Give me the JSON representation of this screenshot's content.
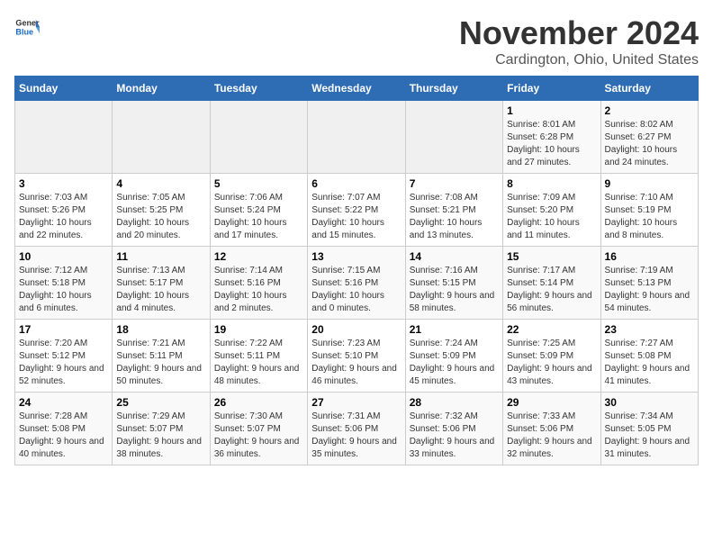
{
  "header": {
    "logo_general": "General",
    "logo_blue": "Blue",
    "title": "November 2024",
    "subtitle": "Cardington, Ohio, United States"
  },
  "calendar": {
    "days_of_week": [
      "Sunday",
      "Monday",
      "Tuesday",
      "Wednesday",
      "Thursday",
      "Friday",
      "Saturday"
    ],
    "weeks": [
      [
        {
          "day": "",
          "info": ""
        },
        {
          "day": "",
          "info": ""
        },
        {
          "day": "",
          "info": ""
        },
        {
          "day": "",
          "info": ""
        },
        {
          "day": "",
          "info": ""
        },
        {
          "day": "1",
          "info": "Sunrise: 8:01 AM\nSunset: 6:28 PM\nDaylight: 10 hours and 27 minutes."
        },
        {
          "day": "2",
          "info": "Sunrise: 8:02 AM\nSunset: 6:27 PM\nDaylight: 10 hours and 24 minutes."
        }
      ],
      [
        {
          "day": "3",
          "info": "Sunrise: 7:03 AM\nSunset: 5:26 PM\nDaylight: 10 hours and 22 minutes."
        },
        {
          "day": "4",
          "info": "Sunrise: 7:05 AM\nSunset: 5:25 PM\nDaylight: 10 hours and 20 minutes."
        },
        {
          "day": "5",
          "info": "Sunrise: 7:06 AM\nSunset: 5:24 PM\nDaylight: 10 hours and 17 minutes."
        },
        {
          "day": "6",
          "info": "Sunrise: 7:07 AM\nSunset: 5:22 PM\nDaylight: 10 hours and 15 minutes."
        },
        {
          "day": "7",
          "info": "Sunrise: 7:08 AM\nSunset: 5:21 PM\nDaylight: 10 hours and 13 minutes."
        },
        {
          "day": "8",
          "info": "Sunrise: 7:09 AM\nSunset: 5:20 PM\nDaylight: 10 hours and 11 minutes."
        },
        {
          "day": "9",
          "info": "Sunrise: 7:10 AM\nSunset: 5:19 PM\nDaylight: 10 hours and 8 minutes."
        }
      ],
      [
        {
          "day": "10",
          "info": "Sunrise: 7:12 AM\nSunset: 5:18 PM\nDaylight: 10 hours and 6 minutes."
        },
        {
          "day": "11",
          "info": "Sunrise: 7:13 AM\nSunset: 5:17 PM\nDaylight: 10 hours and 4 minutes."
        },
        {
          "day": "12",
          "info": "Sunrise: 7:14 AM\nSunset: 5:16 PM\nDaylight: 10 hours and 2 minutes."
        },
        {
          "day": "13",
          "info": "Sunrise: 7:15 AM\nSunset: 5:16 PM\nDaylight: 10 hours and 0 minutes."
        },
        {
          "day": "14",
          "info": "Sunrise: 7:16 AM\nSunset: 5:15 PM\nDaylight: 9 hours and 58 minutes."
        },
        {
          "day": "15",
          "info": "Sunrise: 7:17 AM\nSunset: 5:14 PM\nDaylight: 9 hours and 56 minutes."
        },
        {
          "day": "16",
          "info": "Sunrise: 7:19 AM\nSunset: 5:13 PM\nDaylight: 9 hours and 54 minutes."
        }
      ],
      [
        {
          "day": "17",
          "info": "Sunrise: 7:20 AM\nSunset: 5:12 PM\nDaylight: 9 hours and 52 minutes."
        },
        {
          "day": "18",
          "info": "Sunrise: 7:21 AM\nSunset: 5:11 PM\nDaylight: 9 hours and 50 minutes."
        },
        {
          "day": "19",
          "info": "Sunrise: 7:22 AM\nSunset: 5:11 PM\nDaylight: 9 hours and 48 minutes."
        },
        {
          "day": "20",
          "info": "Sunrise: 7:23 AM\nSunset: 5:10 PM\nDaylight: 9 hours and 46 minutes."
        },
        {
          "day": "21",
          "info": "Sunrise: 7:24 AM\nSunset: 5:09 PM\nDaylight: 9 hours and 45 minutes."
        },
        {
          "day": "22",
          "info": "Sunrise: 7:25 AM\nSunset: 5:09 PM\nDaylight: 9 hours and 43 minutes."
        },
        {
          "day": "23",
          "info": "Sunrise: 7:27 AM\nSunset: 5:08 PM\nDaylight: 9 hours and 41 minutes."
        }
      ],
      [
        {
          "day": "24",
          "info": "Sunrise: 7:28 AM\nSunset: 5:08 PM\nDaylight: 9 hours and 40 minutes."
        },
        {
          "day": "25",
          "info": "Sunrise: 7:29 AM\nSunset: 5:07 PM\nDaylight: 9 hours and 38 minutes."
        },
        {
          "day": "26",
          "info": "Sunrise: 7:30 AM\nSunset: 5:07 PM\nDaylight: 9 hours and 36 minutes."
        },
        {
          "day": "27",
          "info": "Sunrise: 7:31 AM\nSunset: 5:06 PM\nDaylight: 9 hours and 35 minutes."
        },
        {
          "day": "28",
          "info": "Sunrise: 7:32 AM\nSunset: 5:06 PM\nDaylight: 9 hours and 33 minutes."
        },
        {
          "day": "29",
          "info": "Sunrise: 7:33 AM\nSunset: 5:06 PM\nDaylight: 9 hours and 32 minutes."
        },
        {
          "day": "30",
          "info": "Sunrise: 7:34 AM\nSunset: 5:05 PM\nDaylight: 9 hours and 31 minutes."
        }
      ]
    ]
  }
}
